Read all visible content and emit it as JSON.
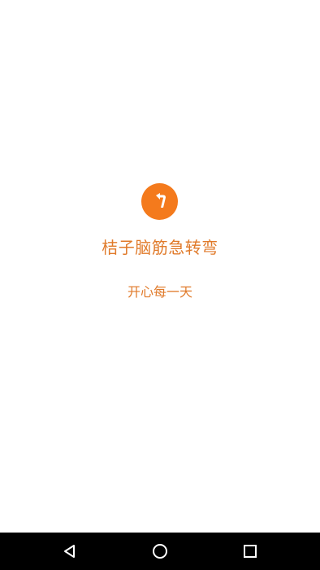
{
  "app": {
    "title": "桔子脑筋急转弯",
    "tagline": "开心每一天",
    "logo_icon": "turn-arrow-icon",
    "accent_color": "#f47a1c",
    "text_color": "#e07a2a"
  },
  "navbar": {
    "buttons": [
      {
        "icon": "back-triangle-icon"
      },
      {
        "icon": "home-circle-icon"
      },
      {
        "icon": "recents-square-icon"
      }
    ]
  }
}
